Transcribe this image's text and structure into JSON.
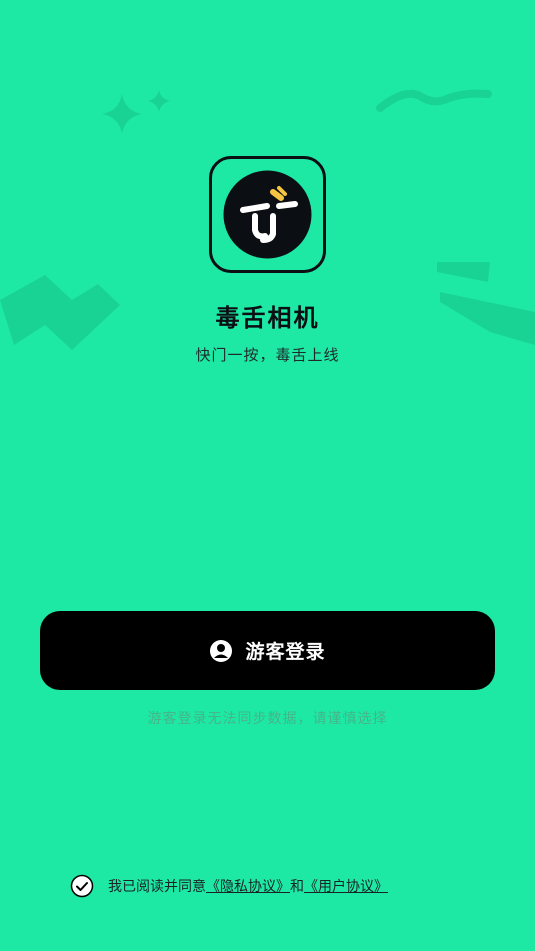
{
  "app": {
    "title": "毒舌相机",
    "subtitle": "快门一按，毒舌上线",
    "logo_icon": "tongue-face-icon"
  },
  "login": {
    "guest_label": "游客登录",
    "guest_icon": "user-circle-icon",
    "hint": "游客登录无法同步数据，请谨慎选择"
  },
  "agreement": {
    "checked": true,
    "prefix": "我已阅读并同意",
    "privacy_link": "《隐私协议》",
    "conjunction": "和",
    "user_link": "《用户协议》"
  },
  "colors": {
    "background": "#1de9a5",
    "button": "#000000",
    "accent": "#f5c542"
  }
}
